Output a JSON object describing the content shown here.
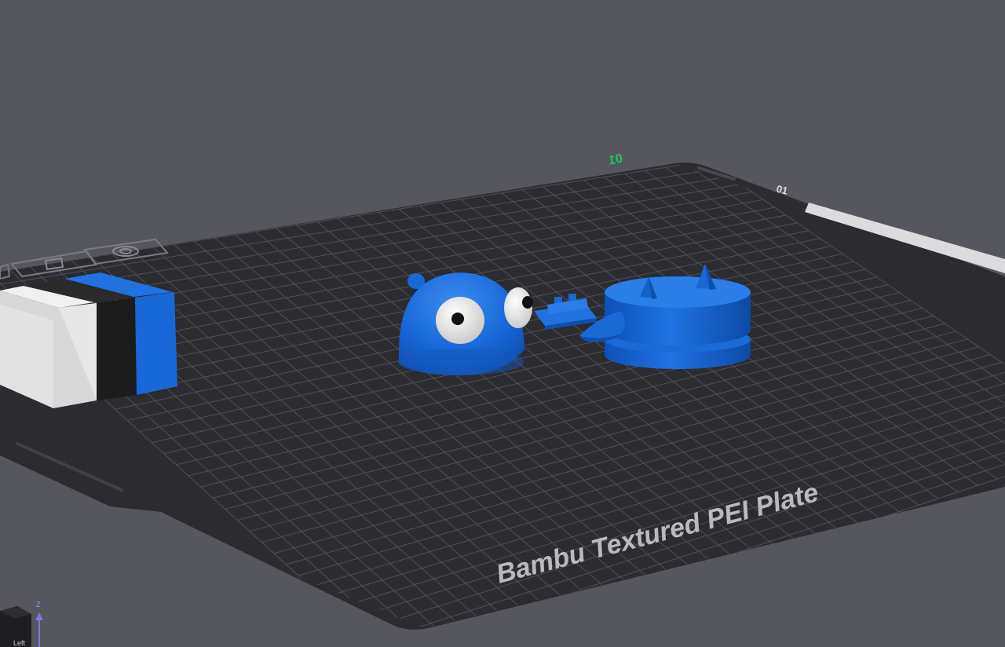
{
  "viewport": {
    "background": "#56565e",
    "plate_label": "Bambu Textured PEI Plate",
    "plate_number": "01",
    "plate_number_color": "#22c55e",
    "plate_color": "#2b2b30",
    "grid_color": "#55555c",
    "model_color": "#1868d8"
  },
  "plate_toolbar": {
    "icons": [
      "arrange-icon",
      "orient-icon",
      "settings-icon"
    ]
  },
  "view_cube": {
    "face_label": "Left",
    "axis_label": "Z"
  },
  "wipe_tower": {
    "colors": [
      "#e6e6e6",
      "#1e1e1e",
      "#1868d8"
    ]
  }
}
